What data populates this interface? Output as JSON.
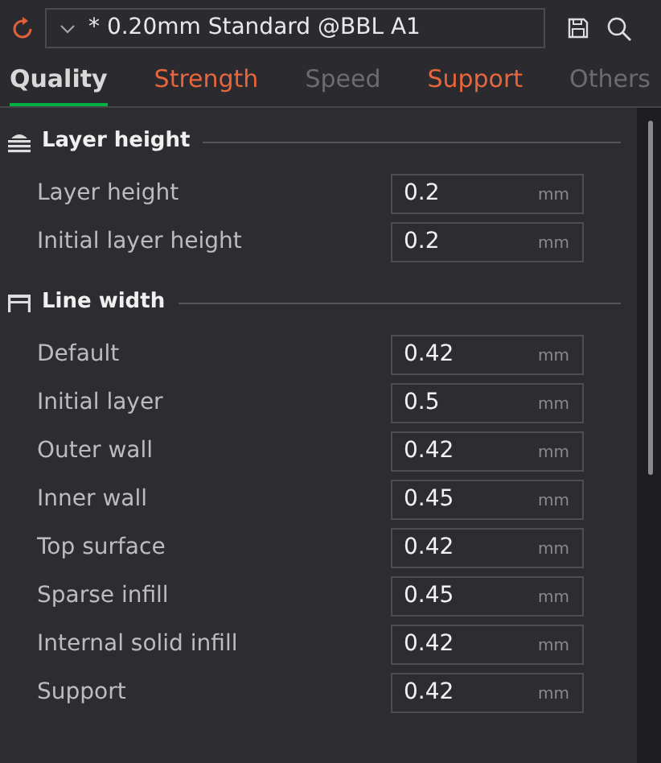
{
  "preset": {
    "name": "* 0.20mm Standard @BBL A1"
  },
  "tabs": [
    {
      "label": "Quality",
      "selected": true,
      "modified": false
    },
    {
      "label": "Strength",
      "selected": false,
      "modified": true
    },
    {
      "label": "Speed",
      "selected": false,
      "modified": false
    },
    {
      "label": "Support",
      "selected": false,
      "modified": true
    },
    {
      "label": "Others",
      "selected": false,
      "modified": false
    }
  ],
  "sections": [
    {
      "title": "Layer height",
      "kind": "layers",
      "rows": [
        {
          "label": "Layer height",
          "value": "0.2",
          "unit": "mm"
        },
        {
          "label": "Initial layer height",
          "value": "0.2",
          "unit": "mm"
        }
      ]
    },
    {
      "title": "Line width",
      "kind": "width",
      "rows": [
        {
          "label": "Default",
          "value": "0.42",
          "unit": "mm"
        },
        {
          "label": "Initial layer",
          "value": "0.5",
          "unit": "mm"
        },
        {
          "label": "Outer wall",
          "value": "0.42",
          "unit": "mm"
        },
        {
          "label": "Inner wall",
          "value": "0.45",
          "unit": "mm"
        },
        {
          "label": "Top surface",
          "value": "0.42",
          "unit": "mm"
        },
        {
          "label": "Sparse infill",
          "value": "0.45",
          "unit": "mm"
        },
        {
          "label": "Internal solid infill",
          "value": "0.42",
          "unit": "mm"
        },
        {
          "label": "Support",
          "value": "0.42",
          "unit": "mm"
        }
      ]
    }
  ]
}
